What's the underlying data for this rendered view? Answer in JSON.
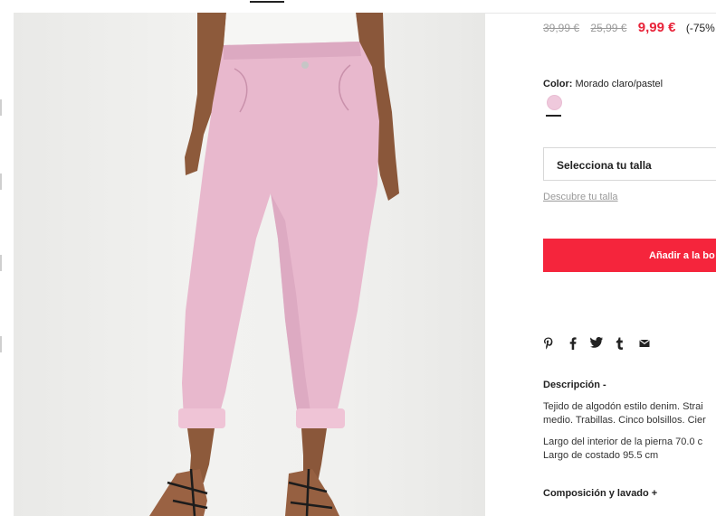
{
  "price": {
    "original_1": "39,99 €",
    "original_2": "25,99 €",
    "current": "9,99 €",
    "discount": "(-75%"
  },
  "color": {
    "label": "Color:",
    "value": "Morado claro/pastel",
    "swatch_color": "#efc9dc"
  },
  "size": {
    "select_label": "Selecciona tu talla",
    "guide_link": "Descubre tu talla"
  },
  "cart": {
    "add_label": "Añadir a la bo"
  },
  "share": {
    "icons": [
      "pinterest-icon",
      "facebook-icon",
      "twitter-icon",
      "tumblr-icon",
      "email-icon"
    ]
  },
  "description": {
    "title": "Descripción -",
    "line_1": "Tejido de algodón estilo denim. Strai",
    "line_2": "medio. Trabillas. Cinco bolsillos. Cier",
    "line_3": "Largo del interior de la pierna 70.0 c",
    "line_4": "Largo de costado 95.5 cm"
  },
  "composition": {
    "title": "Composición y lavado +"
  },
  "colors": {
    "accent": "#f5253c",
    "sale_price": "#e8243a",
    "jeans_pink": "#e8b8cd"
  }
}
